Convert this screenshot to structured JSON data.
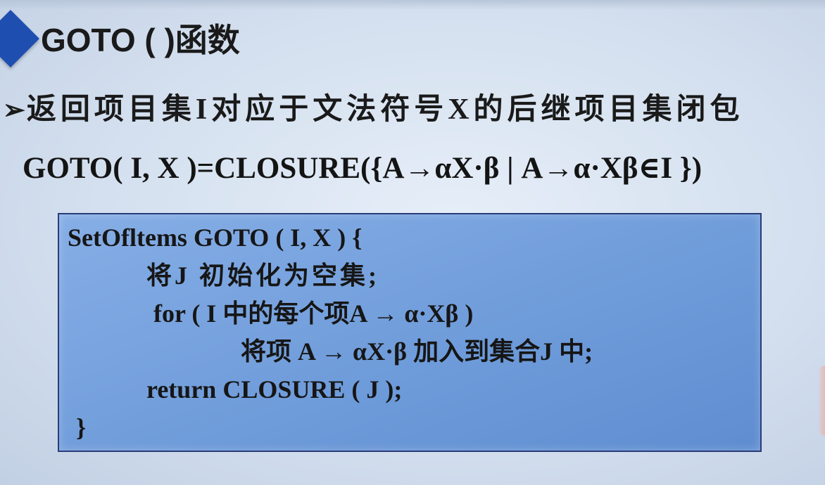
{
  "slide": {
    "title": "GOTO ( )函数",
    "bullet_arrow": "➢",
    "bullet_text": "返回项目集I对应于文法符号X的后继项目集闭包",
    "formula": "GOTO( I, X )=CLOSURE({A→αX·β | A→α·Xβ∈I })"
  },
  "code": {
    "lines": [
      "SetOfltems GOTO ( I,  X ) {",
      "将J 初始化为空集;",
      "for ( I 中的每个项A → α·Xβ )",
      "将项 A → αX·β 加入到集合J 中;",
      "return CLOSURE ( J );",
      "}"
    ]
  }
}
